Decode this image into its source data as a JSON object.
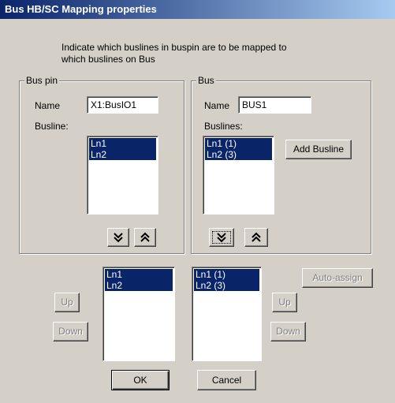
{
  "window": {
    "title": "Bus HB/SC Mapping properties"
  },
  "instructions": {
    "line1": "Indicate which buslines in buspin are to be mapped to",
    "line2": "which buslines on Bus"
  },
  "bus_pin": {
    "group_label": "Bus pin",
    "name_label": "Name",
    "name_value": "X1:BusIO1",
    "busline_label": "Busline:",
    "items": [
      "Ln1",
      "Ln2"
    ],
    "move_down_icon": "double-chevron-down-icon",
    "move_up_icon": "double-chevron-up-icon"
  },
  "bus": {
    "group_label": "Bus",
    "name_label": "Name",
    "name_value": "BUS1",
    "buslines_label": "Buslines:",
    "items": [
      "Ln1 (1)",
      "Ln2 (3)"
    ],
    "add_busline": "Add Busline",
    "move_down_icon": "double-chevron-down-icon",
    "move_up_icon": "double-chevron-up-icon"
  },
  "mapping": {
    "left_items": [
      "Ln1",
      "Ln2"
    ],
    "right_items": [
      "Ln1 (1)",
      "Ln2 (3)"
    ],
    "left_up": "Up",
    "left_down": "Down",
    "right_up": "Up",
    "right_down": "Down",
    "auto_assign": "Auto-assign"
  },
  "footer": {
    "ok": "OK",
    "cancel": "Cancel"
  }
}
